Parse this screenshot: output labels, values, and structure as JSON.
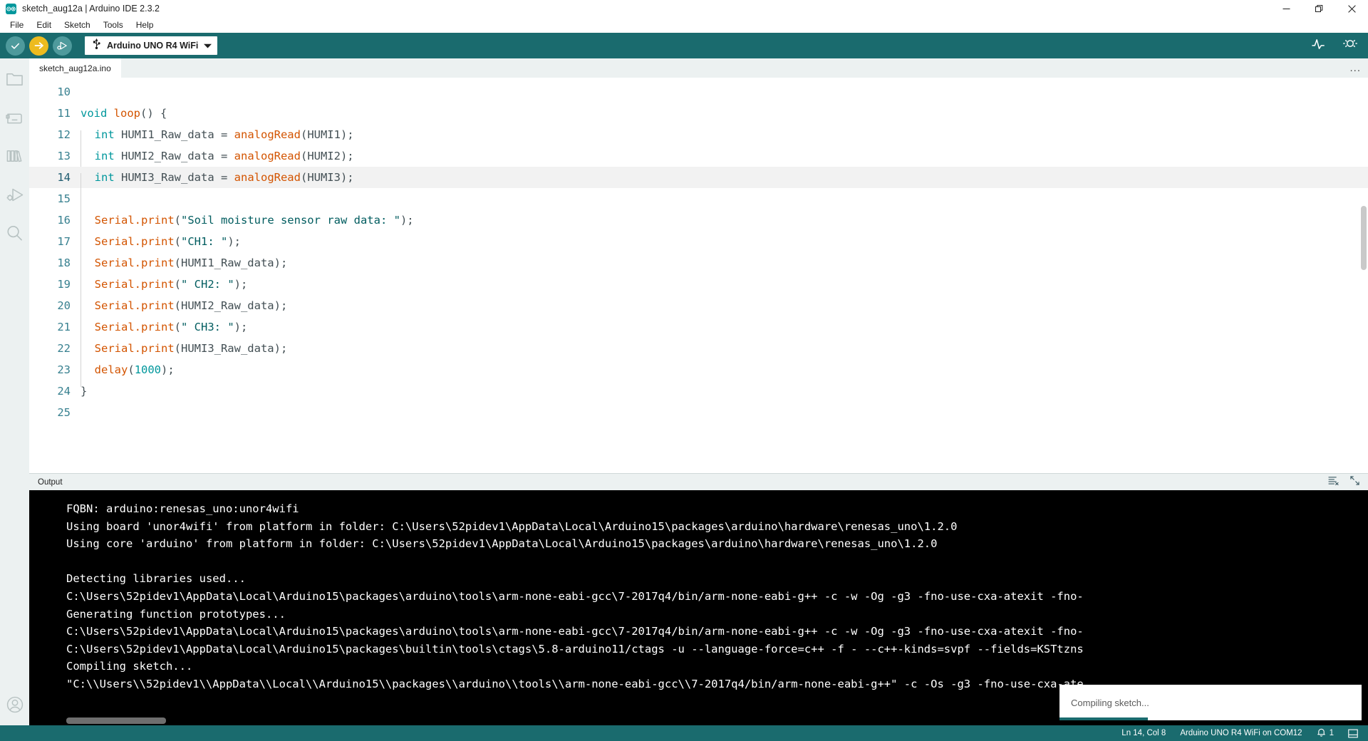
{
  "window": {
    "title": "sketch_aug12a | Arduino IDE 2.3.2",
    "logo_text": "∞",
    "minimize_label": "Minimize",
    "maximize_label": "Restore",
    "close_label": "Close"
  },
  "menu": {
    "items": [
      {
        "label": "File"
      },
      {
        "label": "Edit"
      },
      {
        "label": "Sketch"
      },
      {
        "label": "Tools"
      },
      {
        "label": "Help"
      }
    ]
  },
  "toolbar": {
    "verify_label": "Verify",
    "upload_label": "Upload",
    "debug_label": "Debug",
    "board_name": "Arduino UNO R4 WiFi",
    "serial_plotter_label": "Serial Plotter",
    "serial_monitor_label": "Serial Monitor"
  },
  "sidebar": {
    "items": [
      {
        "name": "sketchbook",
        "label": "Sketchbook"
      },
      {
        "name": "boards-manager",
        "label": "Boards Manager"
      },
      {
        "name": "library-manager",
        "label": "Library Manager"
      },
      {
        "name": "debug",
        "label": "Debug"
      },
      {
        "name": "search",
        "label": "Search"
      }
    ],
    "account_label": "Account"
  },
  "tabs": {
    "items": [
      {
        "label": "sketch_aug12a.ino",
        "active": true
      }
    ],
    "more_label": "..."
  },
  "editor": {
    "active_line": 14,
    "lines": [
      {
        "n": 10,
        "indent": 0,
        "tokens": []
      },
      {
        "n": 11,
        "indent": 0,
        "tokens": [
          {
            "t": "void",
            "c": "kw"
          },
          {
            "t": " ",
            "c": "plain"
          },
          {
            "t": "loop",
            "c": "fn"
          },
          {
            "t": "() {",
            "c": "punct"
          }
        ]
      },
      {
        "n": 12,
        "indent": 1,
        "tokens": [
          {
            "t": "  ",
            "c": "plain"
          },
          {
            "t": "int",
            "c": "kw"
          },
          {
            "t": " HUMI1_Raw_data = ",
            "c": "plain"
          },
          {
            "t": "analogRead",
            "c": "fn"
          },
          {
            "t": "(HUMI1);",
            "c": "punct"
          }
        ]
      },
      {
        "n": 13,
        "indent": 1,
        "tokens": [
          {
            "t": "  ",
            "c": "plain"
          },
          {
            "t": "int",
            "c": "kw"
          },
          {
            "t": " HUMI2_Raw_data = ",
            "c": "plain"
          },
          {
            "t": "analogRead",
            "c": "fn"
          },
          {
            "t": "(HUMI2);",
            "c": "punct"
          }
        ]
      },
      {
        "n": 14,
        "indent": 1,
        "tokens": [
          {
            "t": "  ",
            "c": "plain"
          },
          {
            "t": "int",
            "c": "kw"
          },
          {
            "t": " HUMI3_Raw_data = ",
            "c": "plain"
          },
          {
            "t": "analogRead",
            "c": "fn"
          },
          {
            "t": "(HUMI3);",
            "c": "punct"
          }
        ]
      },
      {
        "n": 15,
        "indent": 1,
        "tokens": []
      },
      {
        "n": 16,
        "indent": 1,
        "tokens": [
          {
            "t": "  ",
            "c": "plain"
          },
          {
            "t": "Serial.print",
            "c": "fn"
          },
          {
            "t": "(",
            "c": "punct"
          },
          {
            "t": "\"Soil moisture sensor raw data: \"",
            "c": "str"
          },
          {
            "t": ");",
            "c": "punct"
          }
        ]
      },
      {
        "n": 17,
        "indent": 1,
        "tokens": [
          {
            "t": "  ",
            "c": "plain"
          },
          {
            "t": "Serial.print",
            "c": "fn"
          },
          {
            "t": "(",
            "c": "punct"
          },
          {
            "t": "\"CH1: \"",
            "c": "str"
          },
          {
            "t": ");",
            "c": "punct"
          }
        ]
      },
      {
        "n": 18,
        "indent": 1,
        "tokens": [
          {
            "t": "  ",
            "c": "plain"
          },
          {
            "t": "Serial.print",
            "c": "fn"
          },
          {
            "t": "(HUMI1_Raw_data);",
            "c": "punct"
          }
        ]
      },
      {
        "n": 19,
        "indent": 1,
        "tokens": [
          {
            "t": "  ",
            "c": "plain"
          },
          {
            "t": "Serial.print",
            "c": "fn"
          },
          {
            "t": "(",
            "c": "punct"
          },
          {
            "t": "\" CH2: \"",
            "c": "str"
          },
          {
            "t": ");",
            "c": "punct"
          }
        ]
      },
      {
        "n": 20,
        "indent": 1,
        "tokens": [
          {
            "t": "  ",
            "c": "plain"
          },
          {
            "t": "Serial.print",
            "c": "fn"
          },
          {
            "t": "(HUMI2_Raw_data);",
            "c": "punct"
          }
        ]
      },
      {
        "n": 21,
        "indent": 1,
        "tokens": [
          {
            "t": "  ",
            "c": "plain"
          },
          {
            "t": "Serial.print",
            "c": "fn"
          },
          {
            "t": "(",
            "c": "punct"
          },
          {
            "t": "\" CH3: \"",
            "c": "str"
          },
          {
            "t": ");",
            "c": "punct"
          }
        ]
      },
      {
        "n": 22,
        "indent": 1,
        "tokens": [
          {
            "t": "  ",
            "c": "plain"
          },
          {
            "t": "Serial.print",
            "c": "fn"
          },
          {
            "t": "(HUMI3_Raw_data);",
            "c": "punct"
          }
        ]
      },
      {
        "n": 23,
        "indent": 1,
        "tokens": [
          {
            "t": "  ",
            "c": "plain"
          },
          {
            "t": "delay",
            "c": "fn"
          },
          {
            "t": "(",
            "c": "punct"
          },
          {
            "t": "1000",
            "c": "num"
          },
          {
            "t": ");",
            "c": "punct"
          }
        ]
      },
      {
        "n": 24,
        "indent": 0,
        "tokens": [
          {
            "t": "}",
            "c": "punct"
          }
        ]
      },
      {
        "n": 25,
        "indent": 0,
        "tokens": []
      }
    ]
  },
  "output": {
    "title": "Output",
    "clear_label": "Clear Output",
    "expand_label": "Toggle Panel",
    "lines": [
      "FQBN: arduino:renesas_uno:unor4wifi",
      "Using board 'unor4wifi' from platform in folder: C:\\Users\\52pidev1\\AppData\\Local\\Arduino15\\packages\\arduino\\hardware\\renesas_uno\\1.2.0",
      "Using core 'arduino' from platform in folder: C:\\Users\\52pidev1\\AppData\\Local\\Arduino15\\packages\\arduino\\hardware\\renesas_uno\\1.2.0",
      "",
      "Detecting libraries used...",
      "C:\\Users\\52pidev1\\AppData\\Local\\Arduino15\\packages\\arduino\\tools\\arm-none-eabi-gcc\\7-2017q4/bin/arm-none-eabi-g++ -c -w -Og -g3 -fno-use-cxa-atexit -fno-",
      "Generating function prototypes...",
      "C:\\Users\\52pidev1\\AppData\\Local\\Arduino15\\packages\\arduino\\tools\\arm-none-eabi-gcc\\7-2017q4/bin/arm-none-eabi-g++ -c -w -Og -g3 -fno-use-cxa-atexit -fno-",
      "C:\\Users\\52pidev1\\AppData\\Local\\Arduino15\\packages\\builtin\\tools\\ctags\\5.8-arduino11/ctags -u --language-force=c++ -f - --c++-kinds=svpf --fields=KSTtzns",
      "Compiling sketch...",
      "\"C:\\\\Users\\\\52pidev1\\\\AppData\\\\Local\\\\Arduino15\\\\packages\\\\arduino\\\\tools\\\\arm-none-eabi-gcc\\\\7-2017q4/bin/arm-none-eabi-g++\" -c -Os -g3 -fno-use-cxa-ate"
    ]
  },
  "toast": {
    "message": "Compiling sketch..."
  },
  "statusbar": {
    "cursor": "Ln 14, Col 8",
    "board_port": "Arduino UNO R4 WiFi on COM12",
    "notification_count": "1",
    "panel_toggle_label": "Toggle Bottom Panel"
  },
  "colors": {
    "accent_teal": "#1a6b6e",
    "upload_yellow": "#edbb1f",
    "verify_green": "#4e9a9c",
    "console_bg": "#000000",
    "sidebar_bg": "#ecf1f1"
  }
}
